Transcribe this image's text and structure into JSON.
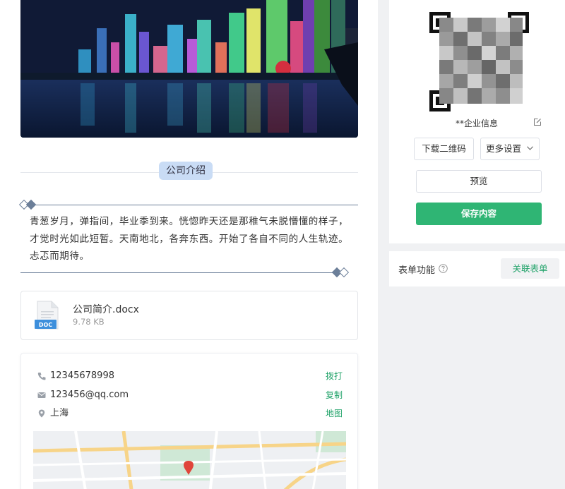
{
  "section": {
    "title": "公司介绍"
  },
  "intro": {
    "text": "青葱岁月，弹指间，毕业季到来。恍惚昨天还是那稚气未脱懵懂的样子，才觉时光如此短暂。天南地北，各奔东西。开始了各自不同的人生轨迹。忐忑而期待。"
  },
  "file": {
    "icon_label": "DOC",
    "name": "公司简介.docx",
    "size": "9.78 KB"
  },
  "contact": {
    "phone": {
      "value": "12345678998",
      "action": "拨打"
    },
    "email": {
      "value": "123456@qq.com",
      "action": "复制"
    },
    "location": {
      "value": "上海",
      "action": "地图"
    }
  },
  "qr": {
    "company_info": "**企业信息"
  },
  "buttons": {
    "download_qr": "下载二维码",
    "more_settings": "更多设置",
    "preview": "预览",
    "save": "保存内容"
  },
  "form": {
    "label": "表单功能",
    "link_button": "关联表单"
  },
  "colors": {
    "accent_green": "#2fb574",
    "section_tag_bg": "#c9dcf5",
    "deco_line": "#6c7f99"
  },
  "icons": [
    "phone-icon",
    "mail-icon",
    "location-icon",
    "edit-icon",
    "chevron-down-icon",
    "help-icon",
    "doc-icon"
  ]
}
